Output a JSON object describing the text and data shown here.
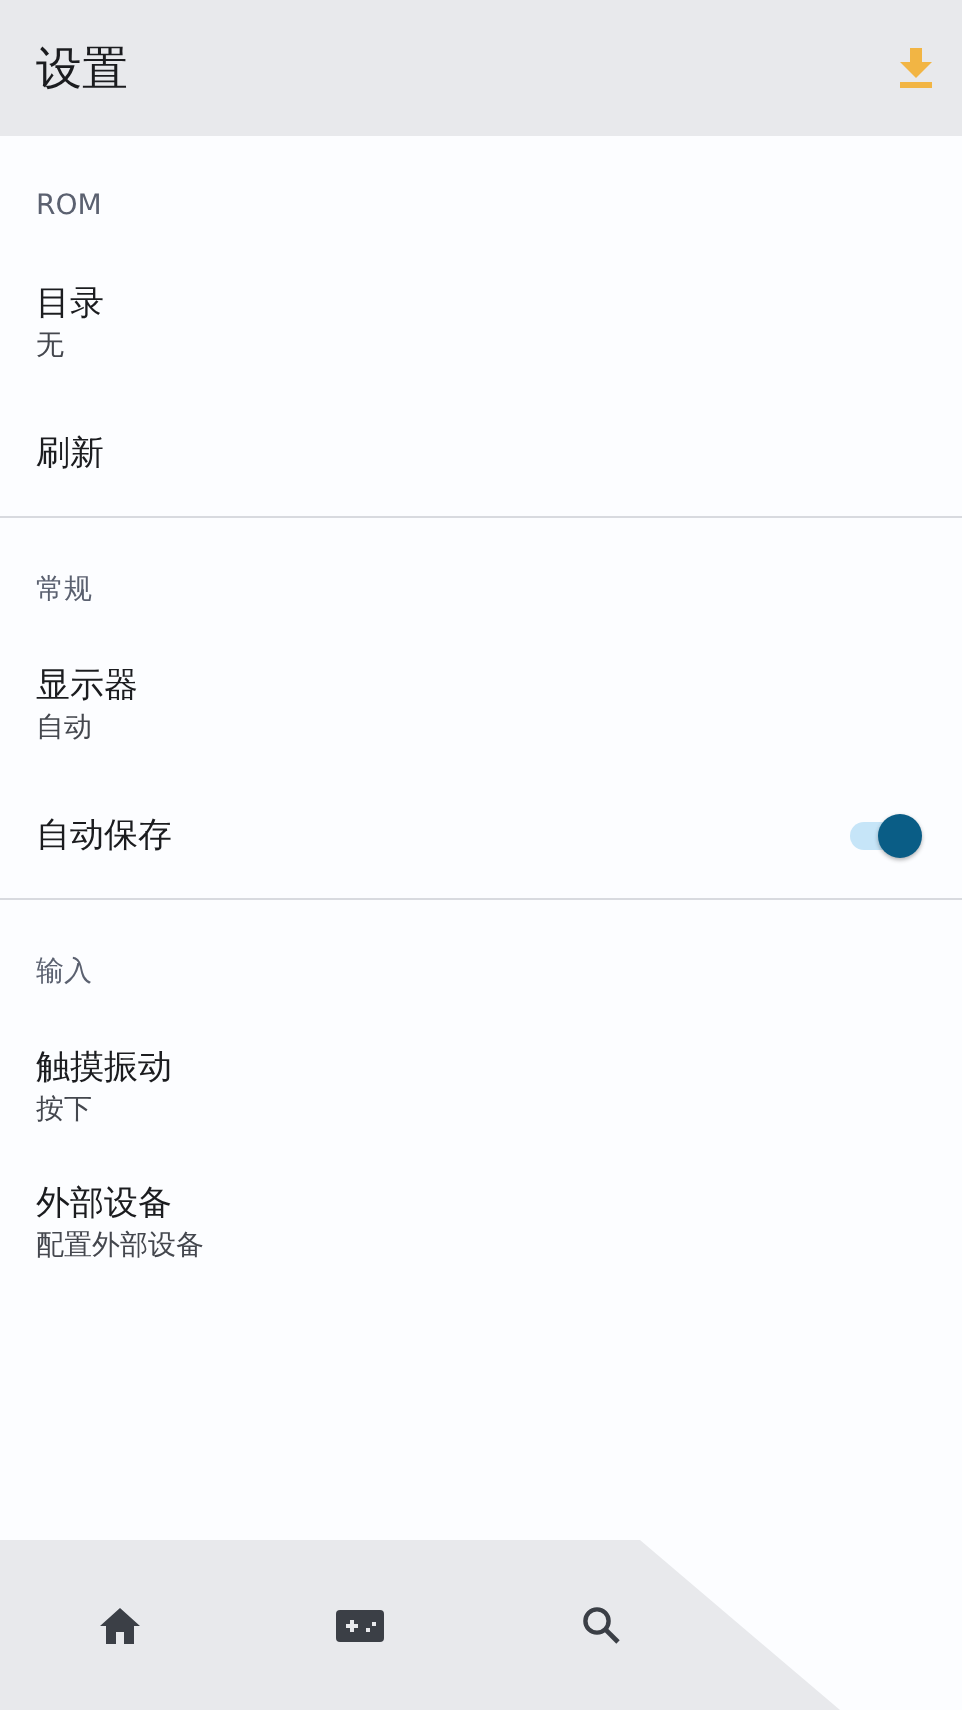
{
  "app_bar": {
    "title": "设置"
  },
  "sections": [
    {
      "title": "ROM",
      "items": [
        {
          "kind": "text",
          "title": "目录",
          "subtitle": "无"
        },
        {
          "kind": "text",
          "title": "刷新"
        }
      ]
    },
    {
      "title": "常规",
      "items": [
        {
          "kind": "text",
          "title": "显示器",
          "subtitle": "自动"
        },
        {
          "kind": "switch",
          "title": "自动保存",
          "on": true
        }
      ]
    },
    {
      "title": "输入",
      "items": [
        {
          "kind": "text",
          "title": "触摸振动",
          "subtitle": "按下"
        },
        {
          "kind": "text",
          "title": "外部设备",
          "subtitle": "配置外部设备"
        }
      ]
    }
  ],
  "bottom_nav": [
    {
      "kind": "home"
    },
    {
      "kind": "games"
    },
    {
      "kind": "search"
    }
  ]
}
